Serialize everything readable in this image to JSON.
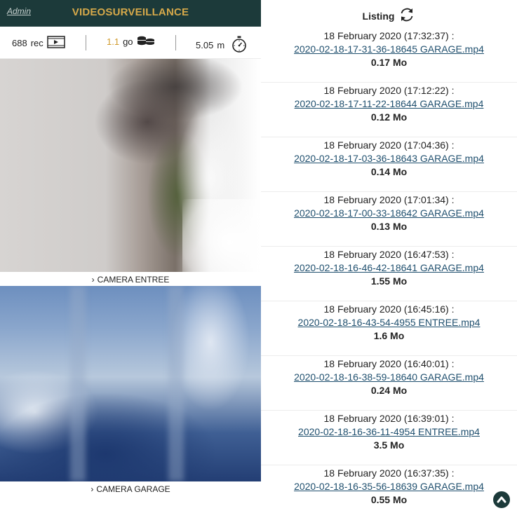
{
  "header": {
    "admin_link": "Admin",
    "app_title": "VIDEOSURVEILLANCE"
  },
  "stats": {
    "records_value": "688",
    "records_unit": "rec",
    "storage_value": "1.1",
    "storage_unit": "go",
    "duration_value": "5.05",
    "duration_unit": "m"
  },
  "cameras": [
    {
      "label": "CAMERA ENTREE"
    },
    {
      "label": "CAMERA GARAGE"
    }
  ],
  "listing": {
    "title": "Listing",
    "entries": [
      {
        "date": "18 February 2020 (17:32:37) :",
        "file": "2020-02-18-17-31-36-18645 GARAGE.mp4",
        "size": "0.17 Mo"
      },
      {
        "date": "18 February 2020 (17:12:22) :",
        "file": "2020-02-18-17-11-22-18644 GARAGE.mp4",
        "size": "0.12 Mo"
      },
      {
        "date": "18 February 2020 (17:04:36) :",
        "file": "2020-02-18-17-03-36-18643 GARAGE.mp4",
        "size": "0.14 Mo"
      },
      {
        "date": "18 February 2020 (17:01:34) :",
        "file": "2020-02-18-17-00-33-18642 GARAGE.mp4",
        "size": "0.13 Mo"
      },
      {
        "date": "18 February 2020 (16:47:53) :",
        "file": "2020-02-18-16-46-42-18641 GARAGE.mp4",
        "size": "1.55 Mo"
      },
      {
        "date": "18 February 2020 (16:45:16) :",
        "file": "2020-02-18-16-43-54-4955 ENTREE.mp4",
        "size": "1.6 Mo"
      },
      {
        "date": "18 February 2020 (16:40:01) :",
        "file": "2020-02-18-16-38-59-18640 GARAGE.mp4",
        "size": "0.24 Mo"
      },
      {
        "date": "18 February 2020 (16:39:01) :",
        "file": "2020-02-18-16-36-11-4954 ENTREE.mp4",
        "size": "3.5 Mo"
      },
      {
        "date": "18 February 2020 (16:37:35) :",
        "file": "2020-02-18-16-35-56-18639 GARAGE.mp4",
        "size": "0.55 Mo"
      }
    ]
  },
  "icons": {
    "video": "video-play-icon",
    "storage": "database-icon",
    "timer": "stopwatch-icon",
    "refresh": "refresh-icon",
    "scroll_top": "chevron-up-icon"
  },
  "colors": {
    "header_bg": "#1c3a3a",
    "title_gold": "#d6a94a",
    "storage_orange": "#d09a2c",
    "link": "#1f4f6e"
  }
}
